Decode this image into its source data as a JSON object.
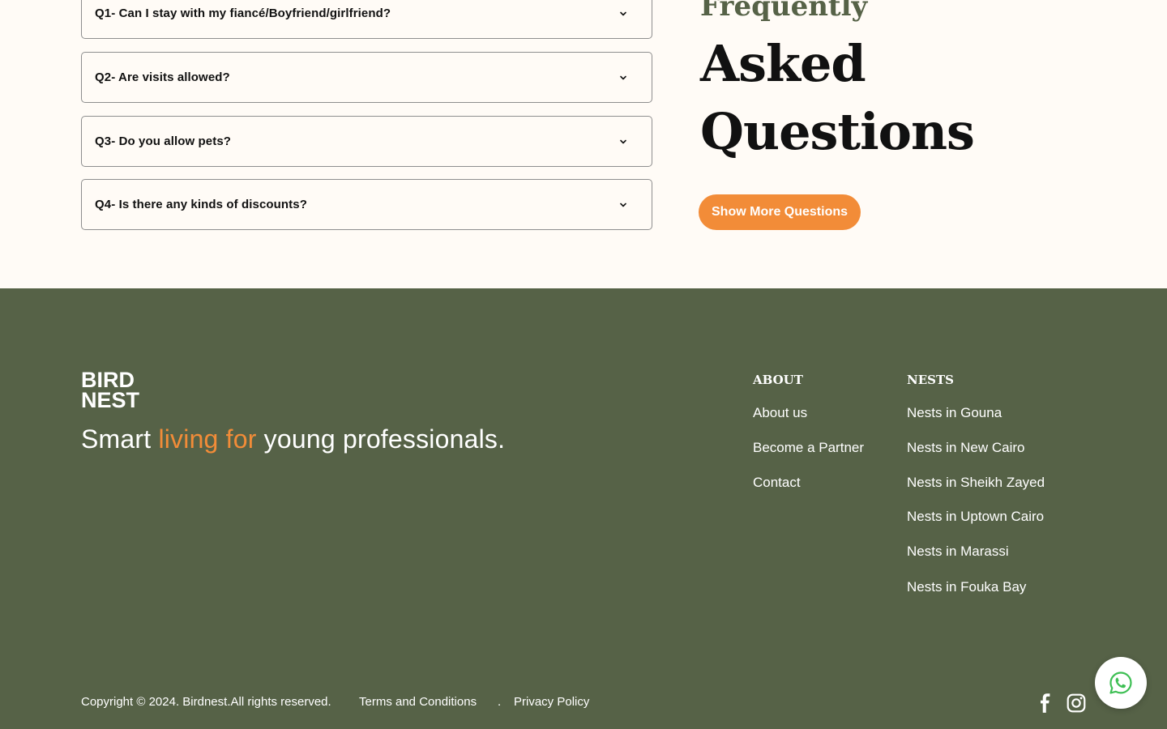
{
  "faq": {
    "items": [
      {
        "question": "Q1- Can I stay with my fiancé/Boyfriend/girlfriend?"
      },
      {
        "question": "Q2- Are visits allowed?"
      },
      {
        "question": "Q3- Do you allow pets?"
      },
      {
        "question": "Q4- Is there any kinds of discounts?"
      }
    ],
    "title_line1": "Frequently",
    "title_line2": "Asked",
    "title_line3": "Questions",
    "more_button": "Show More Questions"
  },
  "footer": {
    "logo_line1": "BIRD",
    "logo_line2": "NEST",
    "tagline_part1": "Smart ",
    "tagline_accent": "living for",
    "tagline_part2": " young professionals.",
    "about": {
      "heading": "ABOUT",
      "links": [
        "About us",
        "Become a Partner",
        "Contact"
      ]
    },
    "nests": {
      "heading": "NESTS",
      "links": [
        "Nests in Gouna",
        "Nests in New Cairo",
        "Nests in Sheikh Zayed",
        "Nests in Uptown Cairo",
        "Nests in Marassi",
        "Nests in Fouka Bay"
      ]
    },
    "copyright": "Copyright © 2024. Birdnest.All rights reserved.",
    "terms": "Terms and Conditions",
    "separator": ".",
    "privacy": "Privacy Policy",
    "social_icons": [
      "facebook-icon",
      "instagram-icon"
    ]
  },
  "whatsapp_icon": "whatsapp-icon",
  "colors": {
    "background": "#fffbf6",
    "footer": "#566247",
    "accent": "#f28c38",
    "title_accent": "#566247"
  }
}
